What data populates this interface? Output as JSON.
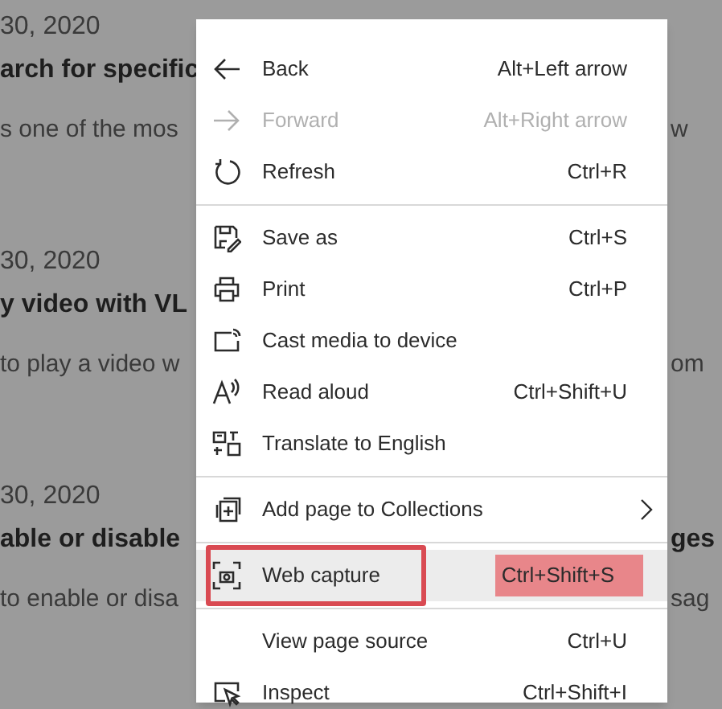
{
  "articles": [
    {
      "date": "30, 2020",
      "title": "arch for specific",
      "snippet": "s one of the mos",
      "snippet_right": "w"
    },
    {
      "date": "30, 2020",
      "title": "y video with VL",
      "snippet": "to play a video w",
      "snippet_right": "om"
    },
    {
      "date": "30, 2020",
      "title": "able or disable",
      "snippet": "to enable or disa",
      "title_right": "ges",
      "snippet_right": "sag"
    }
  ],
  "context_menu": {
    "groups": [
      [
        {
          "kind": "back",
          "label": "Back",
          "shortcut": "Alt+Left arrow",
          "disabled": false
        },
        {
          "kind": "forward",
          "label": "Forward",
          "shortcut": "Alt+Right arrow",
          "disabled": true
        },
        {
          "kind": "refresh",
          "label": "Refresh",
          "shortcut": "Ctrl+R",
          "disabled": false
        }
      ],
      [
        {
          "kind": "save",
          "label": "Save as",
          "shortcut": "Ctrl+S",
          "disabled": false
        },
        {
          "kind": "print",
          "label": "Print",
          "shortcut": "Ctrl+P",
          "disabled": false
        },
        {
          "kind": "cast",
          "label": "Cast media to device",
          "disabled": false
        },
        {
          "kind": "read",
          "label": "Read aloud",
          "shortcut": "Ctrl+Shift+U",
          "disabled": false
        },
        {
          "kind": "translate",
          "label": "Translate to English",
          "disabled": false
        }
      ],
      [
        {
          "kind": "collections",
          "label": "Add page to Collections",
          "submenu": true,
          "disabled": false
        }
      ],
      [
        {
          "kind": "capture",
          "label": "Web capture",
          "shortcut": "Ctrl+Shift+S",
          "disabled": false,
          "selected": true,
          "annotated": true
        }
      ],
      [
        {
          "label": "View page source",
          "shortcut": "Ctrl+U",
          "disabled": false
        },
        {
          "kind": "inspect",
          "label": "Inspect",
          "shortcut": "Ctrl+Shift+I",
          "disabled": false
        }
      ]
    ]
  }
}
